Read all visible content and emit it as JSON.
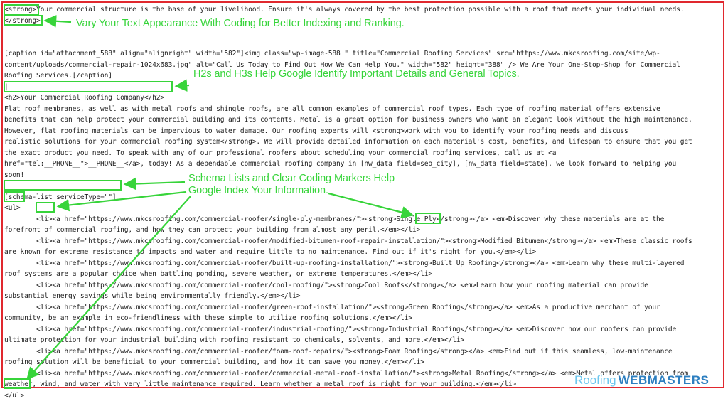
{
  "code_lines": [
    "<strong>Your commercial structure is the base of your livelihood. Ensure it's always covered by the best protection possible with a roof that meets your individual needs.",
    "</strong>",
    "",
    "",
    "[caption id=\"attachment_588\" align=\"alignright\" width=\"582\"]<img class=\"wp-image-588 \" title=\"Commercial Roofing Services\" src=\"https://www.mkcsroofing.com/site/wp-",
    "content/uploads/commercial-repair-1024x683.jpg\" alt=\"Call Us Today to Find Out How We Can Help You.\" width=\"582\" height=\"388\" /> We Are Your One-Stop-Shop for Commercial",
    "Roofing Services.[/caption]",
    "|",
    "<h2>Your Commercial Roofing Company</h2>",
    "Flat roof membranes, as well as with metal roofs and shingle roofs, are all common examples of commercial roof types. Each type of roofing material offers extensive",
    "benefits that can help protect your commercial building and its contents. Metal is a great option for business owners who want an elegant look without the high maintenance.",
    "However, flat roofing materials can be impervious to water damage. Our roofing experts will <strong>work with you to identify your roofing needs and discuss",
    "realistic solutions for your commercial roofing system</strong>. We will provide detailed information on each material's cost, benefits, and lifespan to ensure that you get",
    "the exact product you need. To speak with any of our professional roofers about scheduling your commercial roofing services, call us at <a",
    "href=\"tel:__PHONE__\">__PHONE__</a>, today! As a dependable commercial roofing company in [nw_data field=seo_city], [nw_data field=state], we look forward to helping you",
    "soon!",
    "",
    "[schema-list serviceType=\"\"]",
    "<ul>",
    "        <li><a href=\"https://www.mkcsroofing.com/commercial-roofer/single-ply-membranes/\"><strong>Single Ply</strong></a> <em>Discover why these materials are at the",
    "forefront of commercial roofing, and how they can protect your building from almost any peril.</em></li>",
    "        <li><a href=\"https://www.mkcsroofing.com/commercial-roofer/modified-bitumen-roof-repair-installation/\"><strong>Modified Bitumen</strong></a> <em>These classic roofs",
    "are known for extreme resistance to impacts and water and require little to no maintenance. Find out if it's right for you.</em></li>",
    "        <li><a href=\"https://www.mkcsroofing.com/commercial-roofer/built-up-roofing-installation/\"><strong>Built Up Roofing</strong></a> <em>Learn why these multi-layered",
    "roof systems are a popular choice when battling ponding, severe weather, or extreme temperatures.</em></li>",
    "        <li><a href=\"https://www.mkcsroofing.com/commercial-roofer/cool-roofing/\"><strong>Cool Roofs</strong></a> <em>Learn how your roofing material can provide",
    "substantial energy savings while being environmentally friendly.</em></li>",
    "        <li><a href=\"https://www.mkcsroofing.com/commercial-roofer/green-roof-installation/\"><strong>Green Roofing</strong></a> <em>As a productive merchant of your",
    "community, be an example in eco-friendliness with these simple to utilize roofing solutions.</em></li>",
    "        <li><a href=\"https://www.mkcsroofing.com/commercial-roofer/industrial-roofing/\"><strong>Industrial Roofing</strong></a> <em>Discover how our roofers can provide",
    "ultimate protection for your industrial building with roofing resistant to chemicals, solvents, and more.</em></li>",
    "        <li><a href=\"https://www.mkcsroofing.com/commercial-roofer/foam-roof-repairs/\"><strong>Foam Roofing</strong></a> <em>Find out if this seamless, low-maintenance",
    "roofing solution will be beneficial to your commercial building, and how it can save you money.</em></li>",
    "        <li><a href=\"https://www.mkcsroofing.com/commercial-roofer/commercial-metal-roof-installation/\"><strong>Metal Roofing</strong></a> <em>Metal offers protection from",
    "weather, wind, and water with very little maintenance required. Learn whether a metal roof is right for your building.</em></li>",
    "</ul>"
  ],
  "annotations": {
    "text_appearance": "Vary Your Text Appearance With Coding for Better Indexing and Ranking.",
    "headings": "H2s and H3s Help Google Identify Important Details and General Topics.",
    "schema_line1": "Schema Lists and Clear Coding Markers Help",
    "schema_line2": "Google Index Your Information."
  },
  "brand": {
    "part1": "Roofing",
    "part2": "WEBMASTERS"
  },
  "colors": {
    "frame": "#e0282e",
    "annotation": "#37d43a",
    "brand_light": "#6cc6ee",
    "brand_dark": "#2d7fc0"
  }
}
